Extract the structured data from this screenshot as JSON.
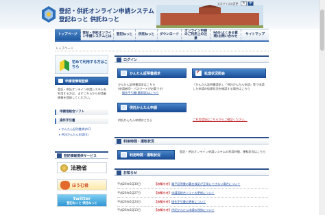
{
  "header": {
    "title_line1": "登記・供託オンライン申請システム",
    "title_line2": "登記ねっと 供託ねっと",
    "fontsize_label": "文字サイズの変更",
    "fontsize_options": [
      "大",
      "中"
    ]
  },
  "nav": {
    "items": [
      {
        "label": "トップページ",
        "active": true
      },
      {
        "label": "登記・供託オンライン申請システムとは",
        "active": false
      },
      {
        "label": "登記ねっと",
        "active": false
      },
      {
        "label": "供託ねっと",
        "active": false
      },
      {
        "label": "ダウンロード",
        "active": false
      },
      {
        "label": "オンライン申請のご利用上の注意",
        "active": false
      },
      {
        "label": "FAQ(よくある質問)お問い合わせ",
        "active": false
      },
      {
        "label": "サイトマップ",
        "active": false
      }
    ]
  },
  "breadcrumb": "トップページ",
  "sidebar": {
    "first_time_label": "初めて利用する方はこちら",
    "register_label": "申請者情報登録",
    "description": "登記・供託オンライン申請システムを利用する方は、まずこちらから申請者情報を登録してください。",
    "section1_head": "申請用総合ソフト",
    "section2_head": "操作手引書",
    "links": [
      "かんたん証明書請求(C)",
      "供託かんたん申請(E)"
    ],
    "banner_head": "登記情報提供サービス",
    "banners": {
      "moj": "法務省",
      "char": "ほうむ君",
      "twitter": "twitter",
      "twitter_sub": "登記ねっと 供託ねっと"
    }
  },
  "login": {
    "head": "ログイン",
    "cert_button": "かんたん証明書請求",
    "cert_desc": "かんたん証明書請求はこちら\n(申請者ID・パスワードが必要です)",
    "cert_link": "操作手引書(簡易版)はこちら",
    "status_button": "処理状況照会",
    "status_desc": "「かんたん証明書請求」、「供託かんたん申請」等で申請した申請の処理状況を確認する場合はこちら",
    "status_link": "ご利用環境はこちらからご確認ください。",
    "deposit_button": "供託かんたん申請",
    "deposit_desc": "供託かんたん申請はこちら"
  },
  "hours": {
    "head": "利用時間・運転状況",
    "button": "利用時間・運転状況",
    "desc": "登記・供託オンライン申請システムの利用時間、運転状況はこちら"
  },
  "news": {
    "head": "お知らせ",
    "items": [
      {
        "date": "平成26年6月30日",
        "tag": "【お知らせ】",
        "title": "電子証明書の署名検証が正常にできない場合について"
      },
      {
        "date": "平成26年6月27日",
        "tag": "【お知らせ】",
        "title": "申請用総合ソフトの更新について"
      },
      {
        "date": "平成26年6月24日",
        "tag": "【お知らせ】",
        "title": "操作手引書の更新について"
      },
      {
        "date": "平成26年6月13日",
        "tag": "【お知らせ】",
        "title": "供託かんたん申請の改修について"
      }
    ]
  },
  "colors": {
    "primary": "#1d4b8f",
    "accent_red": "#c0282d",
    "link": "#2a56a6"
  }
}
